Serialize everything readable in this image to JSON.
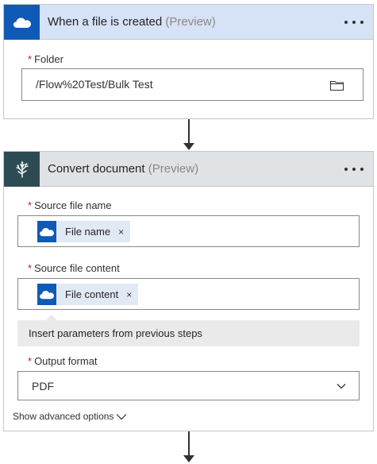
{
  "trigger": {
    "title": "When a file is created",
    "preview": "(Preview)",
    "header_color": "#d6e2f6",
    "icon_bg": "#0f5ab4",
    "icon": "onedrive-cloud-icon",
    "folder": {
      "required_mark": "*",
      "label": "Folder",
      "value": "/Flow%20Test/Bulk Test",
      "icon": "folder-icon"
    }
  },
  "action": {
    "title": "Convert document",
    "preview": "(Preview)",
    "header_color": "#dfe3e5",
    "icon_bg": "#2d4b52",
    "icon": "tree-icon",
    "source_name": {
      "required_mark": "*",
      "label": "Source file name",
      "token": "File name",
      "remove": "×"
    },
    "source_content": {
      "required_mark": "*",
      "label": "Source file content",
      "token": "File content",
      "remove": "×"
    },
    "insert_params": "Insert parameters from previous steps",
    "output_format": {
      "required_mark": "*",
      "label": "Output format",
      "value": "PDF"
    },
    "advanced": "Show advanced options"
  }
}
